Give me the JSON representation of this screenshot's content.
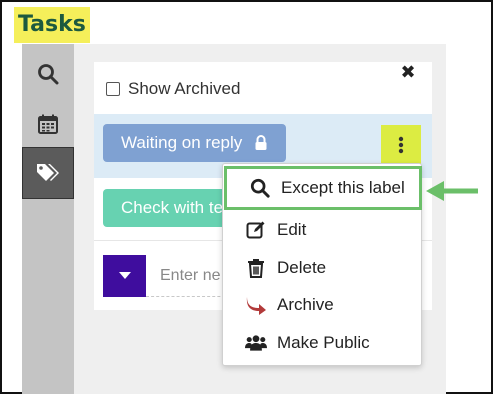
{
  "page": {
    "title": "Tasks"
  },
  "sidebar": {
    "items": [
      {
        "icon": "search-icon",
        "active": false
      },
      {
        "icon": "calendar-icon",
        "active": false
      },
      {
        "icon": "tags-icon",
        "active": true
      }
    ]
  },
  "panel": {
    "show_archived_label": "Show Archived",
    "show_archived_checked": false,
    "close_glyph": "✖",
    "labels": [
      {
        "text": "Waiting on reply",
        "color": "#7fa1d2",
        "locked": true
      },
      {
        "text": "Check with te",
        "color": "#67d2b1",
        "locked": false
      }
    ],
    "new_label_placeholder": "Enter ne"
  },
  "context_menu": {
    "items": [
      {
        "label": "Except this label",
        "icon": "search-icon",
        "highlighted": true
      },
      {
        "label": "Edit",
        "icon": "edit-icon",
        "highlighted": false
      },
      {
        "label": "Delete",
        "icon": "trash-icon",
        "highlighted": false
      },
      {
        "label": "Archive",
        "icon": "archive-arrow-icon",
        "highlighted": false
      },
      {
        "label": "Make Public",
        "icon": "users-icon",
        "highlighted": false
      }
    ]
  },
  "colors": {
    "title_highlight": "#f5ef5a",
    "title_text": "#1c5a3f",
    "kebab_highlight": "#dcec42",
    "menu_highlight_border": "#6bbf69",
    "pointer_arrow": "#6bbf69",
    "add_button": "#3f0d9e",
    "archive_icon": "#b23a3a"
  }
}
